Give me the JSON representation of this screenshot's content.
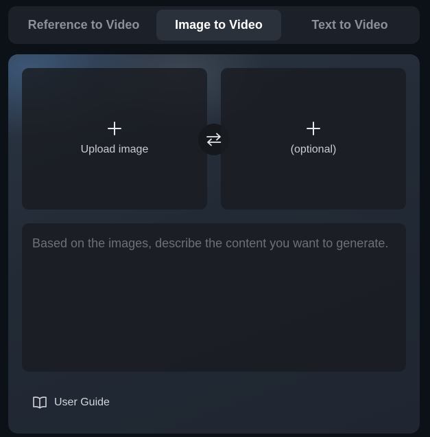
{
  "tabs": [
    {
      "label": "Reference to Video",
      "active": false
    },
    {
      "label": "Image to Video",
      "active": true
    },
    {
      "label": "Text to Video",
      "active": false
    }
  ],
  "upload": {
    "first_label": "Upload image",
    "second_label": "(optional)",
    "plus_icon": "plus-icon",
    "swap_icon": "swap-arrows-icon"
  },
  "prompt": {
    "placeholder": "Based on the images, describe the content you want to generate."
  },
  "guide": {
    "label": "User Guide",
    "icon": "book-icon"
  },
  "colors": {
    "background": "#0c1117",
    "active_tab": "#2b313b",
    "panel": "#222a35"
  }
}
